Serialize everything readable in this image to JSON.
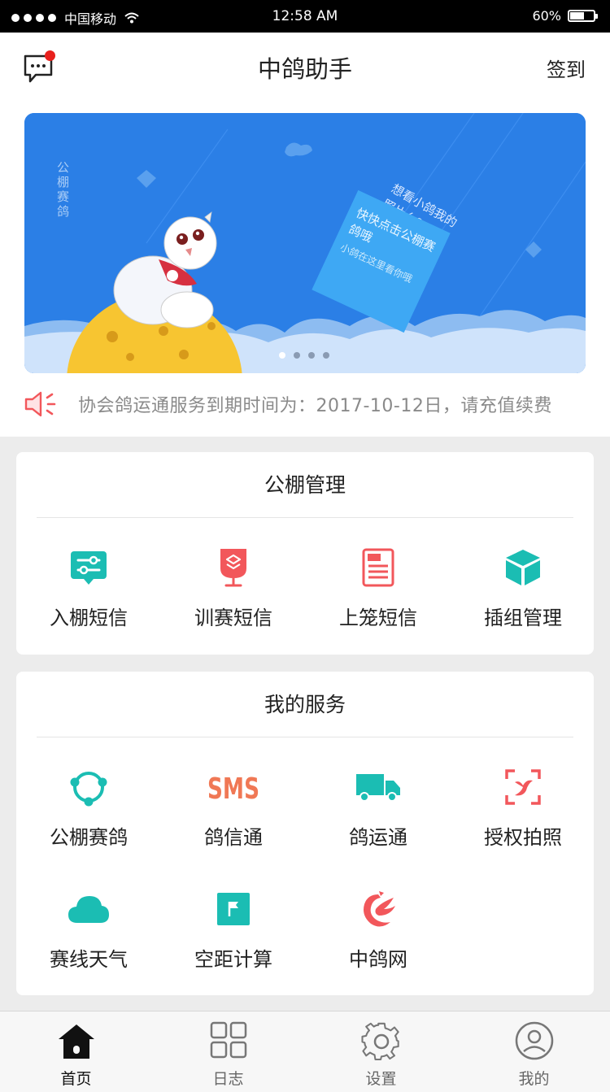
{
  "status_bar": {
    "carrier": "中国移动",
    "time": "12:58  AM",
    "battery": "60%",
    "battery_level": 0.6
  },
  "header": {
    "title": "中鸽助手",
    "signin_label": "签到",
    "message_icon": "message-bubble-icon"
  },
  "banner": {
    "vertical_text": "公棚赛鸽",
    "bubble_text": "想看小鸽我的照片么?",
    "card_title": "快快点击公棚赛鸽哦",
    "card_sub": "小鸽在这里看你哦",
    "page_count": 4,
    "active_page": 1
  },
  "notice": {
    "icon": "speaker-icon",
    "text": "协会鸽运通服务到期时间为：2017-10-12日，请充值续费"
  },
  "loft_management": {
    "title": "公棚管理",
    "items": [
      {
        "label": "入棚短信",
        "icon": "sms-filter-icon",
        "color": "#1bbdb3"
      },
      {
        "label": "训赛短信",
        "icon": "layers-stand-icon",
        "color": "#f2575b"
      },
      {
        "label": "上笼短信",
        "icon": "list-document-icon",
        "color": "#f2575b"
      },
      {
        "label": "插组管理",
        "icon": "cube-icon",
        "color": "#1bbdb3"
      }
    ]
  },
  "my_services": {
    "title": "我的服务",
    "items": [
      {
        "label": "公棚赛鸽",
        "icon": "network-circle-icon",
        "color": "#1bbdb3"
      },
      {
        "label": "鸽信通",
        "icon": "sms-text-icon",
        "color": "#f07855",
        "icon_text": "SMS"
      },
      {
        "label": "鸽运通",
        "icon": "truck-icon",
        "color": "#1bbdb3"
      },
      {
        "label": "授权拍照",
        "icon": "scan-frame-icon",
        "color": "#f2575b"
      },
      {
        "label": "赛线天气",
        "icon": "cloud-icon",
        "color": "#1bbdb3"
      },
      {
        "label": "空距计算",
        "icon": "flag-icon",
        "color": "#1bbdb3"
      },
      {
        "label": "中鸽网",
        "icon": "pigeon-logo-icon",
        "color": "#f2575b"
      }
    ]
  },
  "tabbar": {
    "tabs": [
      {
        "label": "首页",
        "icon": "home-icon",
        "active": true
      },
      {
        "label": "日志",
        "icon": "grid-icon",
        "active": false
      },
      {
        "label": "设置",
        "icon": "gear-icon",
        "active": false
      },
      {
        "label": "我的",
        "icon": "user-icon",
        "active": false
      }
    ]
  }
}
